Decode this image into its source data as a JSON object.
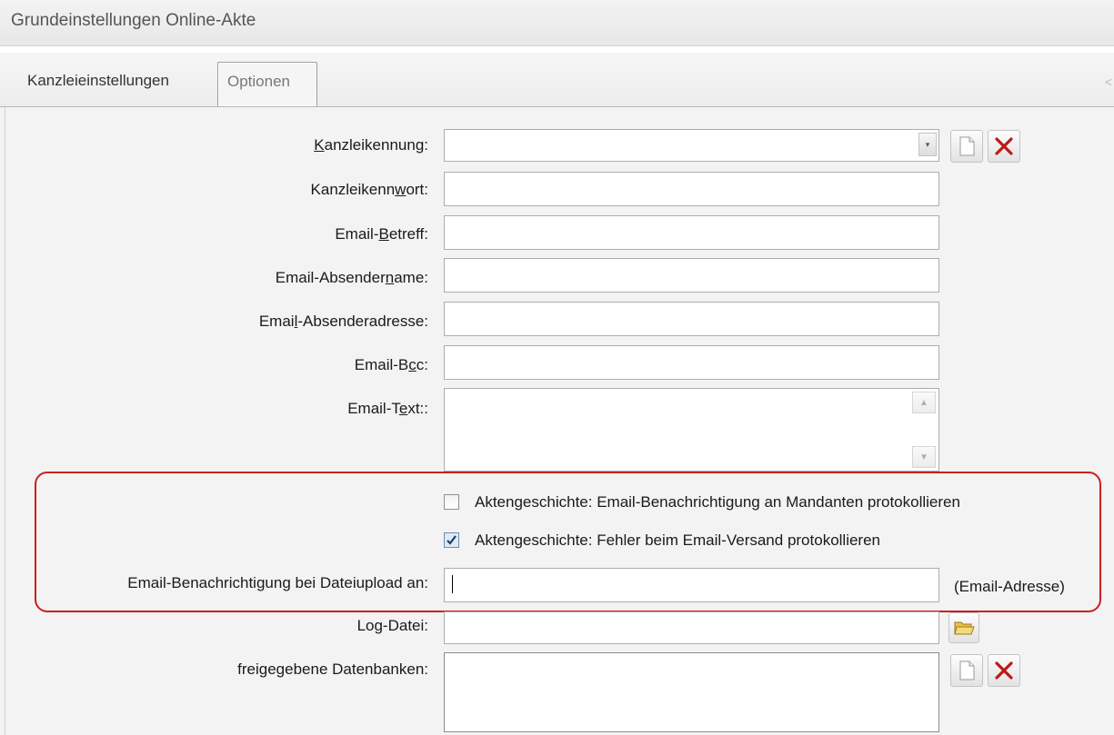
{
  "window": {
    "title": "Grundeinstellungen Online-Akte"
  },
  "tabs": [
    {
      "label": "Kanzleieinstellungen",
      "active": false
    },
    {
      "label": "Optionen",
      "active": true
    }
  ],
  "form": {
    "kanzleikennung": {
      "label_pre": "",
      "label_mnemonic": "K",
      "label_post": "anzleikennung:",
      "value": ""
    },
    "kanzleikennwort": {
      "label_pre": "Kanzleikenn",
      "label_mnemonic": "w",
      "label_post": "ort:",
      "value": ""
    },
    "email_betreff": {
      "label_pre": "Email-",
      "label_mnemonic": "B",
      "label_post": "etreff:",
      "value": ""
    },
    "email_absendername": {
      "label_pre": "Email-Absender",
      "label_mnemonic": "n",
      "label_post": "ame:",
      "value": ""
    },
    "email_absenderadresse": {
      "label_pre": "Emai",
      "label_mnemonic": "l",
      "label_post": "-Absenderadresse:",
      "value": ""
    },
    "email_bcc": {
      "label_pre": "Email-B",
      "label_mnemonic": "c",
      "label_post": "c:",
      "value": ""
    },
    "email_text": {
      "label_pre": "Email-T",
      "label_mnemonic": "e",
      "label_post": "xt::",
      "value": ""
    },
    "checkbox_benachrichtigung": {
      "label": "Aktengeschichte: Email-Benachrichtigung an Mandanten protokollieren",
      "checked": false
    },
    "checkbox_fehler": {
      "label": "Aktengeschichte: Fehler beim Email-Versand protokollieren",
      "checked": true
    },
    "dateiupload": {
      "label": "Email-Benachrichtigung bei Dateiupload an:",
      "value": "",
      "hint": "(Email-Adresse)"
    },
    "log_datei": {
      "label": "Log-Datei:",
      "value": ""
    },
    "datenbanken": {
      "label": "freigegebene Datenbanken:",
      "value": ""
    }
  },
  "icons": {
    "new": "new-document-icon",
    "delete": "delete-x-icon",
    "folder": "open-folder-icon",
    "dropdown": "chevron-down-icon"
  },
  "colors": {
    "highlight_border": "#cc1f1f",
    "delete_x": "#c01818",
    "folder": "#e8c24a"
  }
}
